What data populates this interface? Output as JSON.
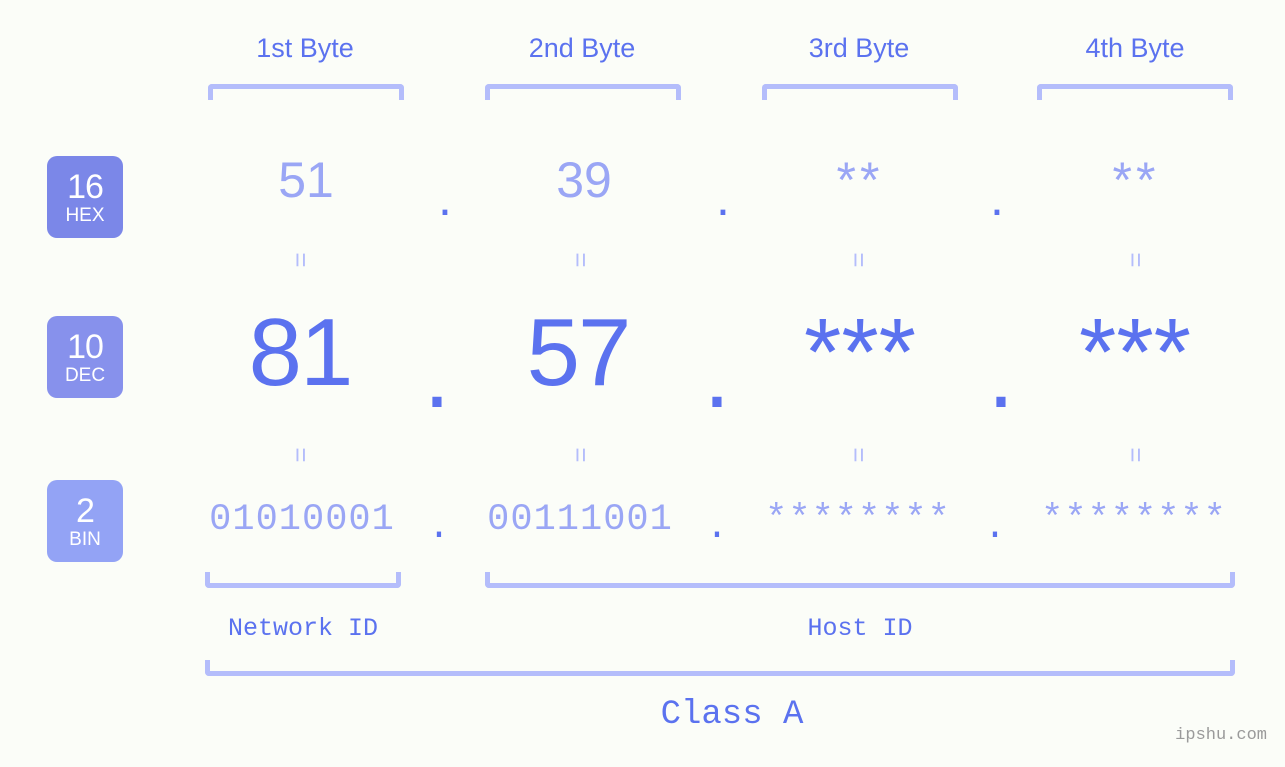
{
  "meta": {
    "background_color": "#fbfdf8",
    "accent_color": "#5b72ef",
    "light_accent_color": "#9aa6f5",
    "bracket_color": "#b4bdfb",
    "watermark_color": "#9a9a9a"
  },
  "headers": [
    {
      "label": "1st Byte"
    },
    {
      "label": "2nd Byte"
    },
    {
      "label": "3rd Byte"
    },
    {
      "label": "4th Byte"
    }
  ],
  "bases": [
    {
      "number": "16",
      "name": "HEX",
      "color": "#7b87e8"
    },
    {
      "number": "10",
      "name": "DEC",
      "color": "#8791ec"
    },
    {
      "number": "2",
      "name": "BIN",
      "color": "#93a3f5"
    }
  ],
  "rows": {
    "hex": {
      "base_number": "16",
      "base_name": "HEX",
      "values": [
        "51",
        "39",
        "**",
        "**"
      ],
      "separator": "."
    },
    "dec": {
      "base_number": "10",
      "base_name": "DEC",
      "values": [
        "81",
        "57",
        "***",
        "***"
      ],
      "separator": "."
    },
    "bin": {
      "base_number": "2",
      "base_name": "BIN",
      "values": [
        "01010001",
        "00111001",
        "********",
        "********"
      ],
      "separator": "."
    }
  },
  "equals_symbol": "=",
  "sections": [
    {
      "label": "Network ID"
    },
    {
      "label": "Host ID"
    }
  ],
  "class": {
    "label": "Class A"
  },
  "watermark": {
    "text": "ipshu.com"
  }
}
